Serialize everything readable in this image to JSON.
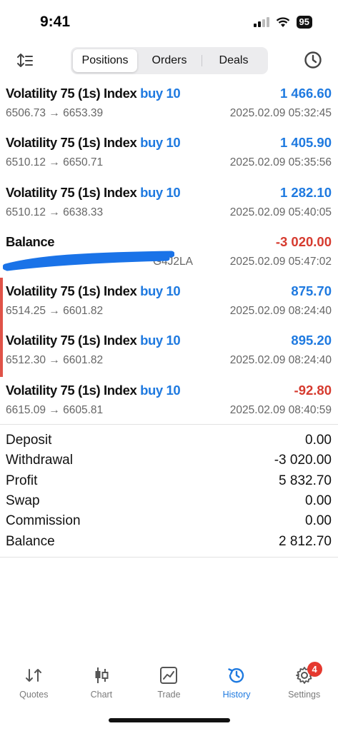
{
  "status": {
    "time": "9:41",
    "battery": "95"
  },
  "toolbar": {
    "segments": [
      "Positions",
      "Orders",
      "Deals"
    ],
    "active_segment": "Positions"
  },
  "trades": [
    {
      "symbol": "Volatility 75 (1s) Index",
      "direction": "buy 10",
      "prices": "6506.73 → 6653.39",
      "time": "2025.02.09 05:32:45",
      "profit": "1 466.60",
      "profit_sign": "pos"
    },
    {
      "symbol": "Volatility 75 (1s) Index",
      "direction": "buy 10",
      "prices": "6510.12 → 6650.71",
      "time": "2025.02.09 05:35:56",
      "profit": "1 405.90",
      "profit_sign": "pos"
    },
    {
      "symbol": "Volatility 75 (1s) Index",
      "direction": "buy 10",
      "prices": "6510.12 → 6638.33",
      "time": "2025.02.09 05:40:05",
      "profit": "1 282.10",
      "profit_sign": "pos"
    },
    {
      "symbol": "Balance",
      "direction": "",
      "prices": "G4J2LA",
      "time": "2025.02.09 05:47:02",
      "profit": "-3 020.00",
      "profit_sign": "neg"
    },
    {
      "symbol": "Volatility 75 (1s) Index",
      "direction": "buy 10",
      "prices": "6514.25 → 6601.82",
      "time": "2025.02.09 08:24:40",
      "profit": "875.70",
      "profit_sign": "pos"
    },
    {
      "symbol": "Volatility 75 (1s) Index",
      "direction": "buy 10",
      "prices": "6512.30 → 6601.82",
      "time": "2025.02.09 08:24:40",
      "profit": "895.20",
      "profit_sign": "pos"
    },
    {
      "symbol": "Volatility 75 (1s) Index",
      "direction": "buy 10",
      "prices": "6615.09 → 6605.81",
      "time": "2025.02.09 08:40:59",
      "profit": "-92.80",
      "profit_sign": "neg"
    }
  ],
  "summary": [
    {
      "label": "Deposit",
      "value": "0.00"
    },
    {
      "label": "Withdrawal",
      "value": "-3 020.00"
    },
    {
      "label": "Profit",
      "value": "5 832.70"
    },
    {
      "label": "Swap",
      "value": "0.00"
    },
    {
      "label": "Commission",
      "value": "0.00"
    },
    {
      "label": "Balance",
      "value": "2 812.70"
    }
  ],
  "tabbar": {
    "items": [
      {
        "label": "Quotes",
        "icon": "quotes-icon"
      },
      {
        "label": "Chart",
        "icon": "chart-icon"
      },
      {
        "label": "Trade",
        "icon": "trade-icon"
      },
      {
        "label": "History",
        "icon": "history-icon"
      },
      {
        "label": "Settings",
        "icon": "settings-icon"
      }
    ],
    "active": "History",
    "settings_badge": "4"
  },
  "colors": {
    "accent_blue": "#1f7ae0",
    "loss_red": "#d63b2f",
    "side_bar_red": "#e05348",
    "redaction_blue": "#1a73e8"
  }
}
